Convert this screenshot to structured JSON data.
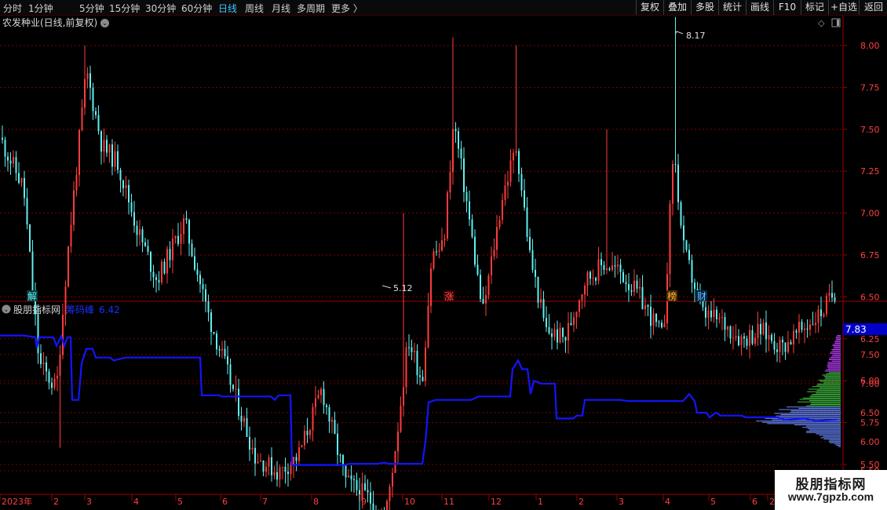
{
  "toolbar": {
    "tabs": [
      "分时",
      "1分钟",
      "5分钟",
      "15分钟",
      "30分钟",
      "60分钟",
      "日线",
      "周线",
      "月线",
      "多周期",
      "更多 〉"
    ],
    "active_tab": "日线",
    "right_buttons": [
      "复权",
      "叠加",
      "多股",
      "统计",
      "画线",
      "F10",
      "标记",
      "+自选",
      "返回"
    ]
  },
  "main_chart": {
    "title": "农发种业(日线,前复权)",
    "high_label": "8.17",
    "low_label": "5.12",
    "y_ticks": [
      "8.00",
      "7.75",
      "7.50",
      "7.25",
      "7.00",
      "6.75",
      "6.50",
      "6.25",
      "6.00",
      "5.75",
      "5.50"
    ],
    "event_markers": [
      "解",
      "涨",
      "榜",
      "财"
    ]
  },
  "indicator": {
    "name": "股朋指标网",
    "label": "筹码峰",
    "value": "6.42",
    "current_price_tag": "7.83",
    "y_ticks": [
      "7.50",
      "7.00",
      "6.50",
      "6.00",
      "5.50"
    ]
  },
  "time_axis": {
    "labels": [
      "2023年",
      "2",
      "3",
      "4",
      "5",
      "6",
      "7",
      "8",
      "9",
      "10",
      "11",
      "12",
      "1",
      "2",
      "3",
      "4",
      "5",
      "6",
      "2"
    ]
  },
  "watermark": {
    "line1": "股朋指标网",
    "line2": "www.7gpzb.com"
  },
  "colors": {
    "up": "#ff3c3c",
    "down": "#5ff0f0",
    "grid": "#7a0000",
    "indicator_line": "#1414ff",
    "active_tab": "#3ec8ff"
  }
}
